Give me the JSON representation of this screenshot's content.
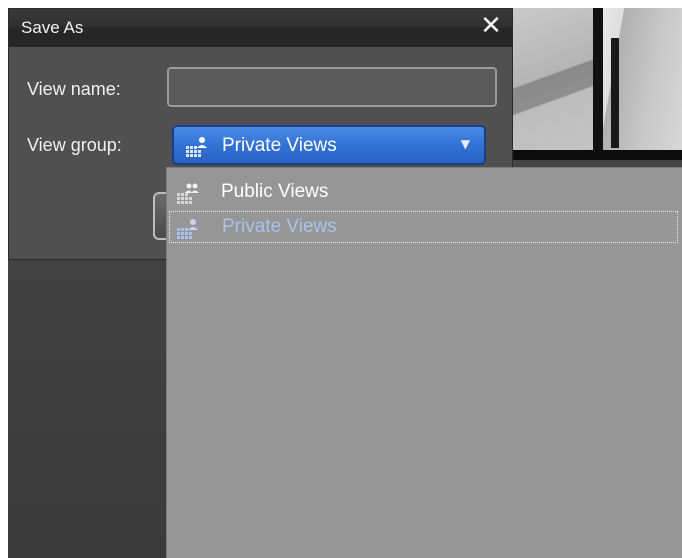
{
  "dialog": {
    "title": "Save As",
    "close_glyph": "✕",
    "view_name_label": "View name:",
    "view_name_value": "",
    "view_group_label": "View group:",
    "view_group_selected": "Private Views",
    "select_arrow": "▼",
    "select_icon": "views-group-icon"
  },
  "dropdown": {
    "options": [
      {
        "label": "Public Views",
        "icon": "views-group-icon"
      },
      {
        "label": "Private Views",
        "icon": "views-group-icon"
      }
    ],
    "highlighted_index": 1
  },
  "colors": {
    "select_accent": "#3272d6",
    "dropdown_bg": "#969696",
    "highlight_text": "#a9c3ec"
  }
}
